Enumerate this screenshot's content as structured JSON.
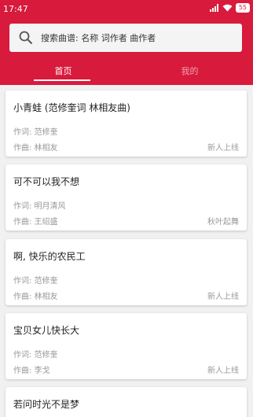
{
  "status": {
    "time": "17:47",
    "battery": "55"
  },
  "search": {
    "placeholder": "搜索曲谱: 名称 词作者 曲作者"
  },
  "tabs": [
    {
      "label": "首页",
      "active": true
    },
    {
      "label": "我的",
      "active": false
    }
  ],
  "songs": [
    {
      "title": "小青蛙 (范修奎词 林相友曲)",
      "lyricist": "作词: 范修奎",
      "composer": "作曲: 林相友",
      "uploader": "新人上线"
    },
    {
      "title": "可不可以我不想",
      "lyricist": "作词: 明月清风",
      "composer": "作曲: 王绍盛",
      "uploader": "秋叶起舞"
    },
    {
      "title": "啊, 快乐的农民工",
      "lyricist": "作词: 范修奎",
      "composer": "作曲: 林相友",
      "uploader": "新人上线"
    },
    {
      "title": "宝贝女儿快长大",
      "lyricist": "作词: 范修奎",
      "composer": "作曲: 李戈",
      "uploader": "新人上线"
    },
    {
      "title": "若问时光不是梦",
      "lyricist": "",
      "composer": "",
      "uploader": ""
    }
  ],
  "colors": {
    "accent": "#d81a3c",
    "background": "#f1f1f1"
  }
}
